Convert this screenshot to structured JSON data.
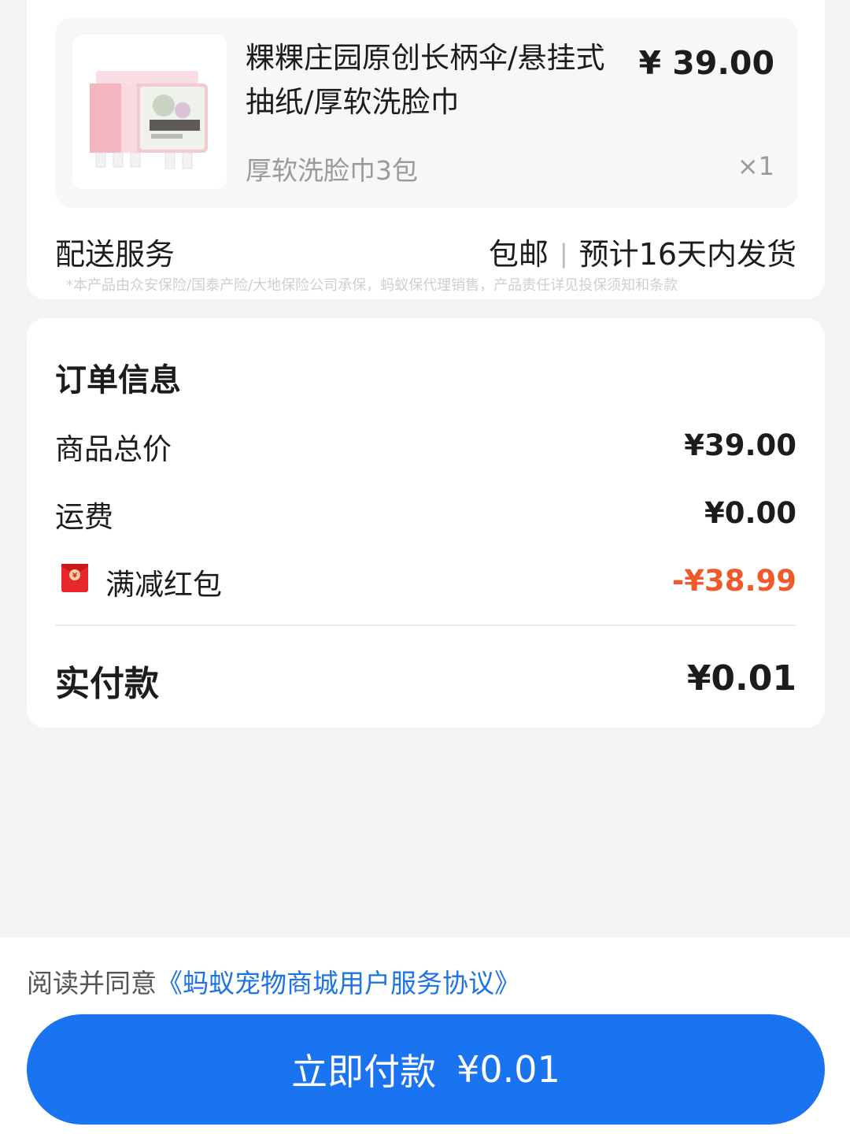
{
  "product": {
    "title": "粿粿庄园原创长柄伞/悬挂式抽纸/厚软洗脸巾",
    "price": "¥ 39.00",
    "spec": "厚软洗脸巾3包",
    "quantity": "×1",
    "image_icon": "product-image-icon"
  },
  "delivery": {
    "label": "配送服务",
    "shipping": "包邮",
    "separator": "|",
    "estimate": "预计16天内发货",
    "disclaimer": "*本产品由众安保险/国泰产险/大地保险公司承保，蚂蚁保代理销售，产品责任详见投保须知和条款"
  },
  "order_info": {
    "title": "订单信息",
    "rows": [
      {
        "label": "商品总价",
        "value": "¥39.00"
      },
      {
        "label": "运费",
        "value": "¥0.00"
      },
      {
        "label": "满减红包",
        "value": "-¥38.99",
        "icon": "red-packet-icon"
      }
    ],
    "total_label": "实付款",
    "total_value": "¥0.01"
  },
  "footer": {
    "agree_prefix": "阅读并同意",
    "agree_link": "《蚂蚁宠物商城用户服务协议》",
    "pay_label": "立即付款",
    "pay_amount": "¥0.01"
  },
  "colors": {
    "accent": "#1a73f0",
    "link": "#1e73e6",
    "discount": "#f0592b",
    "red_packet": "#e8262b",
    "background": "#f4f4f4"
  }
}
